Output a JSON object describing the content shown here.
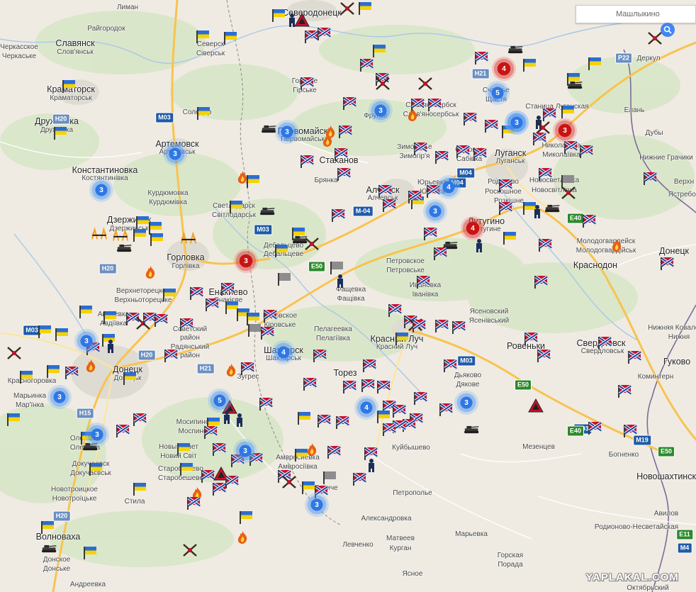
{
  "search": {
    "placeholder": "Машлыкино"
  },
  "watermark": "YAPLAKAL.COM",
  "colors": {
    "ukraine_blue": "#2a6dd6",
    "ukraine_yellow": "#f5d300",
    "novorossia_red": "#c8102e",
    "cluster_blue": "#2d78e6",
    "cluster_red": "#c81414"
  },
  "shields": [
    "M03",
    "M03",
    "M03",
    "H20",
    "H20",
    "H20",
    "H21",
    "H21",
    "M-04",
    "M04",
    "E50",
    "E50",
    "E50",
    "E40",
    "M03",
    "H15",
    "H20",
    "P22",
    "M19",
    "E11",
    "M4",
    "M03",
    "M04",
    "E40"
  ],
  "labels": [
    {
      "t": "Лиман",
      "c": "sub"
    },
    {
      "t": "Райгородок",
      "c": "sub"
    },
    {
      "t": "Славянск",
      "c": "city"
    },
    {
      "t": "Слов'янськ",
      "c": "sub"
    },
    {
      "t": "Черкасское",
      "c": "sub"
    },
    {
      "t": "Черкаське",
      "c": "sub"
    },
    {
      "t": "Краматорск",
      "c": "city"
    },
    {
      "t": "Краматорськ",
      "c": "sub"
    },
    {
      "t": "Дружковка",
      "c": "city"
    },
    {
      "t": "Дружківка",
      "c": "sub"
    },
    {
      "t": "Константиновка",
      "c": "city"
    },
    {
      "t": "Костянтинівка",
      "c": "sub"
    },
    {
      "t": "Северск",
      "c": "sub"
    },
    {
      "t": "Сіверськ",
      "c": "sub"
    },
    {
      "t": "Северодонецк",
      "c": "city"
    },
    {
      "t": "Соледар",
      "c": "sub"
    },
    {
      "t": "Артемовск",
      "c": "city"
    },
    {
      "t": "Артемівськ",
      "c": "sub"
    },
    {
      "t": "Курдюмовка",
      "c": "sub"
    },
    {
      "t": "Курдюмівка",
      "c": "sub"
    },
    {
      "t": "Дзержинск",
      "c": "city"
    },
    {
      "t": "Дзержинськ",
      "c": "sub"
    },
    {
      "t": "Горловка",
      "c": "city"
    },
    {
      "t": "Горлівка",
      "c": "sub"
    },
    {
      "t": "Светлодарск",
      "c": "sub"
    },
    {
      "t": "Світлодарськ",
      "c": "sub"
    },
    {
      "t": "Дебальцево",
      "c": "sub"
    },
    {
      "t": "Дебальцеве",
      "c": "sub"
    },
    {
      "t": "Верхнеторецкое",
      "c": "sub"
    },
    {
      "t": "Верхньоторецьке",
      "c": "sub"
    },
    {
      "t": "Енакиево",
      "c": "city"
    },
    {
      "t": "Єнакієве",
      "c": "sub"
    },
    {
      "t": "Авдеевка",
      "c": "sub"
    },
    {
      "t": "Авдіївка",
      "c": "sub"
    },
    {
      "t": "Советский",
      "c": "sub"
    },
    {
      "t": "район",
      "c": "sub"
    },
    {
      "t": "Радянський",
      "c": "sub"
    },
    {
      "t": "район",
      "c": "sub"
    },
    {
      "t": "Донецк",
      "c": "city"
    },
    {
      "t": "Донецьк",
      "c": "sub"
    },
    {
      "t": "Красногоровка",
      "c": "sub"
    },
    {
      "t": "Марьинка",
      "c": "sub"
    },
    {
      "t": "Мар'їнка",
      "c": "sub"
    },
    {
      "t": "Олeнiвка",
      "c": "sub"
    },
    {
      "t": "Оленівка",
      "c": "sub"
    },
    {
      "t": "Докучаевск",
      "c": "sub"
    },
    {
      "t": "Докучаєвськ",
      "c": "sub"
    },
    {
      "t": "Новотроицкое",
      "c": "sub"
    },
    {
      "t": "Новотроїцьке",
      "c": "sub"
    },
    {
      "t": "Стила",
      "c": "sub"
    },
    {
      "t": "Волноваха",
      "c": "city"
    },
    {
      "t": "Донское",
      "c": "sub"
    },
    {
      "t": "Донське",
      "c": "sub"
    },
    {
      "t": "Андреевка",
      "c": "sub"
    },
    {
      "t": "Мосипино",
      "c": "sub"
    },
    {
      "t": "Моспино",
      "c": "sub"
    },
    {
      "t": "Новый Свет",
      "c": "sub"
    },
    {
      "t": "Новий Світ",
      "c": "sub"
    },
    {
      "t": "Старобешево",
      "c": "sub"
    },
    {
      "t": "Старобешеве",
      "c": "sub"
    },
    {
      "t": "Зугрес",
      "c": "sub"
    },
    {
      "t": "Шахтерск",
      "c": "city"
    },
    {
      "t": "Шахтарськ",
      "c": "sub"
    },
    {
      "t": "Пелагеевка",
      "c": "sub"
    },
    {
      "t": "Пелагіївка",
      "c": "sub"
    },
    {
      "t": "Торез",
      "c": "city"
    },
    {
      "t": "Кировское",
      "c": "sub"
    },
    {
      "t": "Кірoвське",
      "c": "sub"
    },
    {
      "t": "Фащевка",
      "c": "sub"
    },
    {
      "t": "Фащівка",
      "c": "sub"
    },
    {
      "t": "Амвросиевка",
      "c": "sub"
    },
    {
      "t": "Амвросіївка",
      "c": "sub"
    },
    {
      "t": "Лисиче",
      "c": "sub"
    },
    {
      "t": "Александровка",
      "c": "sub"
    },
    {
      "t": "Левченко",
      "c": "sub"
    },
    {
      "t": "Матвеев",
      "c": "sub"
    },
    {
      "t": "Курган",
      "c": "sub"
    },
    {
      "t": "Ясное",
      "c": "sub"
    },
    {
      "t": "Петрополье",
      "c": "sub"
    },
    {
      "t": "Марьевка",
      "c": "sub"
    },
    {
      "t": "Горская",
      "c": "sub"
    },
    {
      "t": "Порада",
      "c": "sub"
    },
    {
      "t": "Куйбышево",
      "c": "sub"
    },
    {
      "t": "Горское",
      "c": "sub"
    },
    {
      "t": "Гірське",
      "c": "sub"
    },
    {
      "t": "Первомайск",
      "c": "city"
    },
    {
      "t": "Первомайськ",
      "c": "sub"
    },
    {
      "t": "Стаханов",
      "c": "city"
    },
    {
      "t": "Брянка",
      "c": "sub"
    },
    {
      "t": "Алчевск",
      "c": "city"
    },
    {
      "t": "Алчевськ",
      "c": "sub"
    },
    {
      "t": "Фрунзе",
      "c": "sub"
    },
    {
      "t": "Славяносербск",
      "c": "sub"
    },
    {
      "t": "Слов'яносербськ",
      "c": "sub"
    },
    {
      "t": "Зимогорье",
      "c": "sub"
    },
    {
      "t": "Зимогір'я",
      "c": "sub"
    },
    {
      "t": "Луганск",
      "c": "city"
    },
    {
      "t": "Луганськ",
      "c": "sub"
    },
    {
      "t": "Счастье",
      "c": "sub"
    },
    {
      "t": "Щастя",
      "c": "sub"
    },
    {
      "t": "Станица Луганская",
      "c": "sub"
    },
    {
      "t": "Николаевка",
      "c": "sub"
    },
    {
      "t": "Миколаївка",
      "c": "sub"
    },
    {
      "t": "Сабовка",
      "c": "sub"
    },
    {
      "t": "Сабівка",
      "c": "sub"
    },
    {
      "t": "Юрьевка",
      "c": "sub"
    },
    {
      "t": "Юр'ївка",
      "c": "sub"
    },
    {
      "t": "Родаково",
      "c": "sub"
    },
    {
      "t": "Роскошное",
      "c": "sub"
    },
    {
      "t": "Розкішне",
      "c": "sub"
    },
    {
      "t": "Новосветловка",
      "c": "sub"
    },
    {
      "t": "Новосвітлівка",
      "c": "sub"
    },
    {
      "t": "Лутугино",
      "c": "city"
    },
    {
      "t": "Лутугине",
      "c": "sub"
    },
    {
      "t": "Петровское",
      "c": "sub"
    },
    {
      "t": "Петровське",
      "c": "sub"
    },
    {
      "t": "Ивановка",
      "c": "sub"
    },
    {
      "t": "Іванівка",
      "c": "sub"
    },
    {
      "t": "Красный Луч",
      "c": "city"
    },
    {
      "t": "Красний Луч",
      "c": "sub"
    },
    {
      "t": "Ясеновский",
      "c": "sub"
    },
    {
      "t": "Ясенівський",
      "c": "sub"
    },
    {
      "t": "Ровеньки",
      "c": "city"
    },
    {
      "t": "Свердловск",
      "c": "city"
    },
    {
      "t": "Свердловськ",
      "c": "sub"
    },
    {
      "t": "Дьяково",
      "c": "sub"
    },
    {
      "t": "Дякове",
      "c": "sub"
    },
    {
      "t": "Мезенцев",
      "c": "sub"
    },
    {
      "t": "Молодогвардейск",
      "c": "sub"
    },
    {
      "t": "Молодогвардійськ",
      "c": "sub"
    },
    {
      "t": "Краснодон",
      "c": "city"
    },
    {
      "t": "Донецк",
      "c": "city"
    },
    {
      "t": "Нижняя Ковалевка",
      "c": "sub"
    },
    {
      "t": "Нижня",
      "c": "sub"
    },
    {
      "t": "Гуково",
      "c": "city"
    },
    {
      "t": "Коминтерн",
      "c": "sub"
    },
    {
      "t": "Богненко",
      "c": "sub"
    },
    {
      "t": "Новошахтинск",
      "c": "city"
    },
    {
      "t": "Авилов",
      "c": "sub"
    },
    {
      "t": "Родионово-Несветайская",
      "c": "sub"
    },
    {
      "t": "Октябрьский",
      "c": "sub"
    },
    {
      "t": "Елань",
      "c": "sub"
    },
    {
      "t": "Дубы",
      "c": "sub"
    },
    {
      "t": "Деркул",
      "c": "sub"
    },
    {
      "t": "Нижние Грачики",
      "c": "sub"
    },
    {
      "t": "Верхн",
      "c": "sub"
    },
    {
      "t": "Ястребовка",
      "c": "sub"
    }
  ],
  "clusters": [
    {
      "n": "3",
      "k": "blue"
    },
    {
      "n": "3",
      "k": "blue"
    },
    {
      "n": "3",
      "k": "blue"
    },
    {
      "n": "3",
      "k": "blue"
    },
    {
      "n": "3",
      "k": "blue"
    },
    {
      "n": "5",
      "k": "blue"
    },
    {
      "n": "3",
      "k": "blue"
    },
    {
      "n": "3",
      "k": "blue"
    },
    {
      "n": "4",
      "k": "blue"
    },
    {
      "n": "3",
      "k": "blue"
    },
    {
      "n": "4",
      "k": "blue"
    },
    {
      "n": "3",
      "k": "blue"
    },
    {
      "n": "3",
      "k": "blue"
    },
    {
      "n": "4",
      "k": "blue"
    },
    {
      "n": "3",
      "k": "blue"
    },
    {
      "n": "5",
      "k": "blue"
    },
    {
      "n": "3",
      "k": "blue"
    },
    {
      "n": "3",
      "k": "blue"
    },
    {
      "n": "4",
      "k": "red"
    },
    {
      "n": "3",
      "k": "red"
    },
    {
      "n": "3",
      "k": "red"
    },
    {
      "n": "4",
      "k": "red"
    }
  ]
}
